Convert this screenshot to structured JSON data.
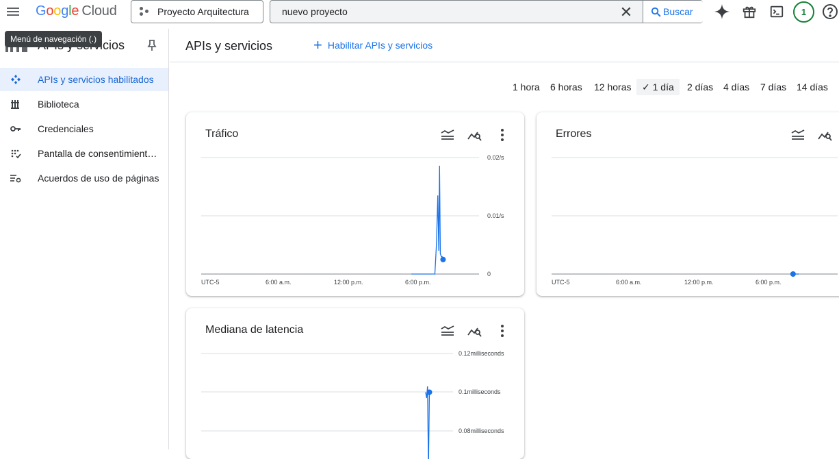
{
  "app": {
    "logo_word": "Google",
    "logo_product": "Cloud"
  },
  "header": {
    "project_name": "Proyecto Arquitectura",
    "search_value": "nuevo proyecto",
    "search_button": "Buscar",
    "notifications_count": "1"
  },
  "tooltip": "Menú de navegación (.)",
  "sidebar": {
    "title": "APIs y servicios",
    "items": [
      {
        "label": "APIs y servicios habilitados",
        "icon": "api-diamond-icon",
        "active": true
      },
      {
        "label": "Biblioteca",
        "icon": "library-icon",
        "active": false
      },
      {
        "label": "Credenciales",
        "icon": "key-icon",
        "active": false
      },
      {
        "label": "Pantalla de consentimiento de OAuth",
        "icon": "consent-screen-icon",
        "active": false
      },
      {
        "label": "Acuerdos de uso de páginas",
        "icon": "page-usage-settings-icon",
        "active": false
      }
    ]
  },
  "main": {
    "title": "APIs y servicios",
    "enable_button": "Habilitar APIs y servicios",
    "time_ranges": [
      "1 hora",
      "6 horas",
      "12 horas",
      "1 día",
      "2 días",
      "4 días",
      "7 días",
      "14 días"
    ],
    "selected_range": "1 día"
  },
  "accent_color": "#1a73e8",
  "chart_data": [
    {
      "type": "line",
      "title": "Tráfico",
      "x_ticks": [
        "UTC-5",
        "6:00 a.m.",
        "12:00 p.m.",
        "6:00 p.m."
      ],
      "y_ticks": [
        "0.02/s",
        "0.01/s",
        "0"
      ],
      "ylim": [
        0,
        0.02
      ],
      "series": [
        {
          "x": [
            "18:00",
            "20:00",
            "20:08",
            "20:15",
            "20:20",
            "20:24",
            "20:28",
            "20:33",
            "20:37",
            "20:42",
            "20:50"
          ],
          "values": [
            0,
            0,
            0.005,
            0.0135,
            0.004,
            0.0186,
            0.0035,
            0.003,
            0.003,
            0.0025,
            0.0025
          ]
        }
      ],
      "grid": true
    },
    {
      "type": "line",
      "title": "Errores",
      "x_ticks": [
        "UTC-5",
        "6:00 a.m.",
        "12:00 p.m.",
        "6:00 p.m."
      ],
      "y_ticks": [
        "0"
      ],
      "series": [
        {
          "x": [
            "20:40",
            "21:10"
          ],
          "values": [
            0,
            0
          ]
        }
      ],
      "grid": true
    },
    {
      "type": "line",
      "title": "Mediana de latencia",
      "y_ticks": [
        "0.12milliseconds",
        "0.1milliseconds",
        "0.08milliseconds"
      ],
      "ylim": [
        0.08,
        0.12
      ],
      "series": [
        {
          "x": [
            "20:00",
            "20:05",
            "20:10",
            "20:15",
            "20:20",
            "20:40"
          ],
          "values": [
            0.1,
            0.097,
            0.103,
            0.06,
            0.1,
            0.1
          ]
        }
      ],
      "grid": true
    }
  ]
}
